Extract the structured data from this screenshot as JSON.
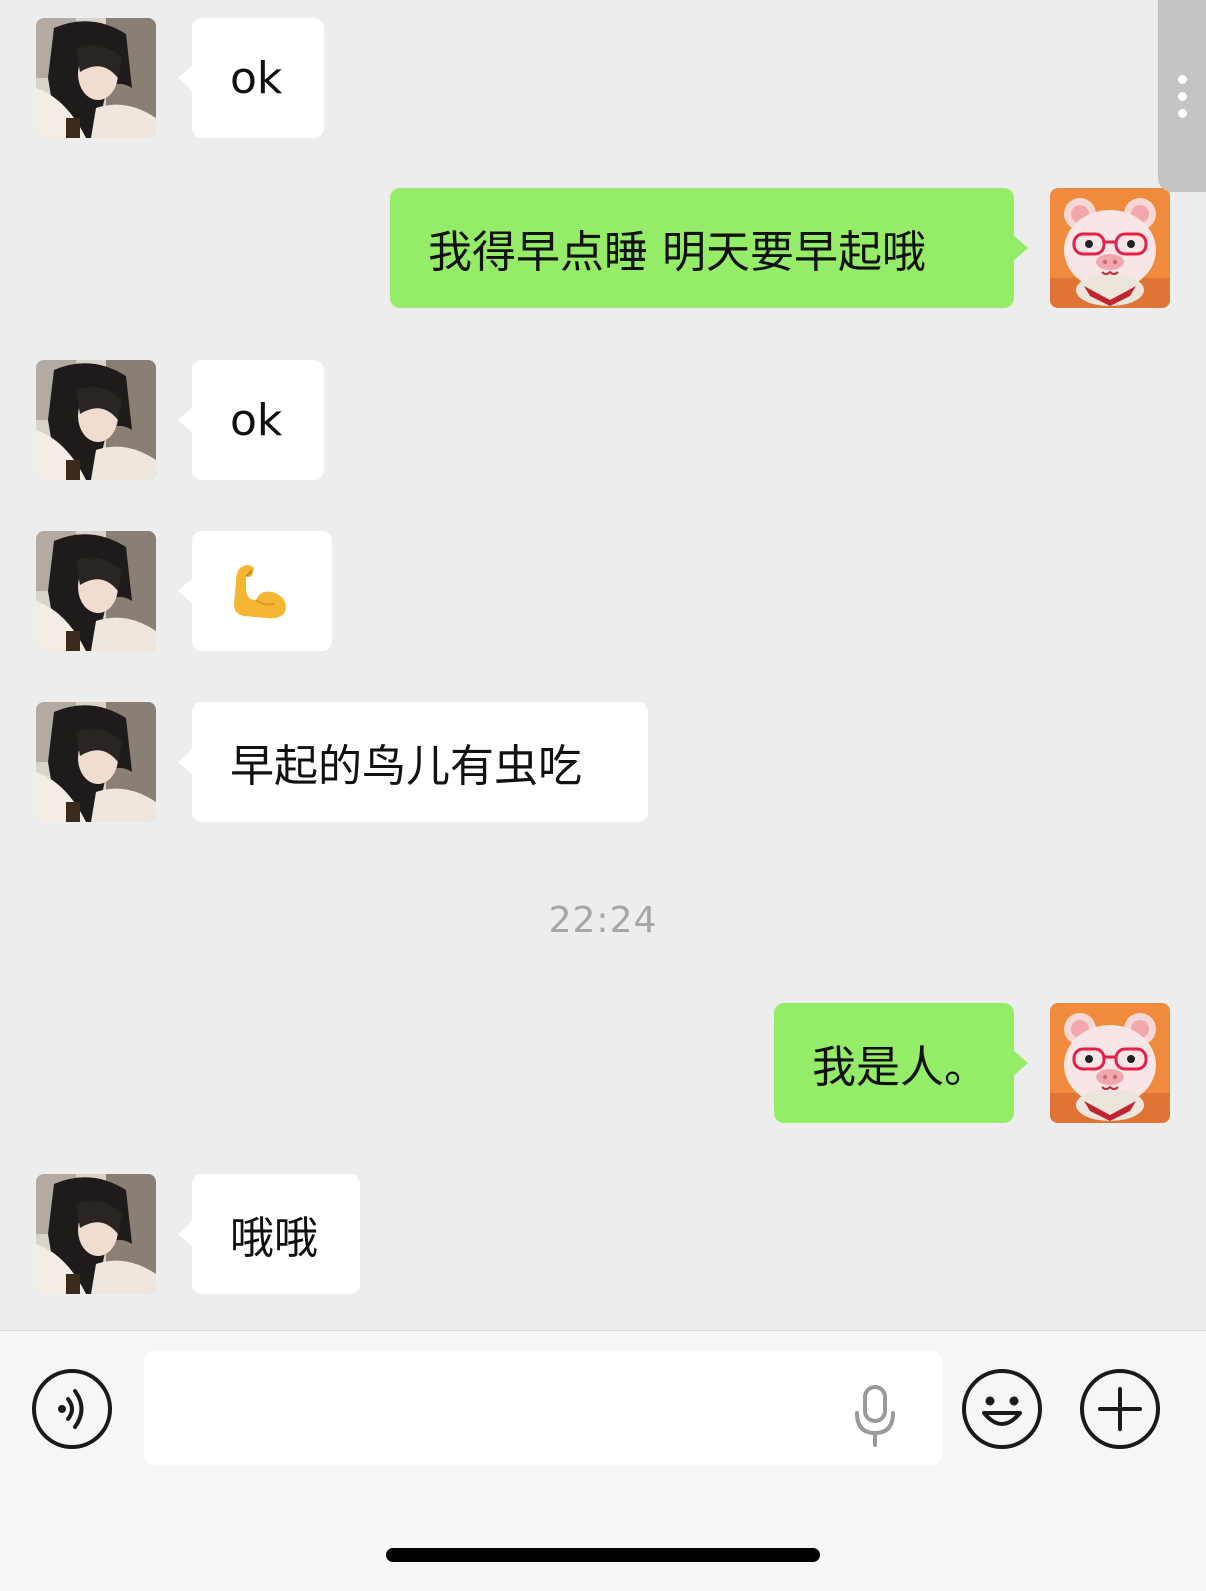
{
  "messages": [
    {
      "from": "contact",
      "text": "ok"
    },
    {
      "from": "me",
      "text": "我得早点睡 明天要早起哦"
    },
    {
      "from": "contact",
      "text": "ok"
    },
    {
      "from": "contact",
      "emoji": "flexed-biceps"
    },
    {
      "from": "contact",
      "text": "早起的鸟儿有虫吃"
    },
    {
      "from": "me",
      "text": "我是人。"
    },
    {
      "from": "contact",
      "text": "哦哦"
    }
  ],
  "timestamp": "22:24",
  "colors": {
    "background": "#ededed",
    "sent_bubble": "#95ec69",
    "received_bubble": "#ffffff",
    "timestamp": "#a6a6a6"
  },
  "input_bar": {
    "text_value": "",
    "icons": [
      "voice-icon",
      "microphone-icon",
      "emoji-icon",
      "plus-icon"
    ]
  }
}
